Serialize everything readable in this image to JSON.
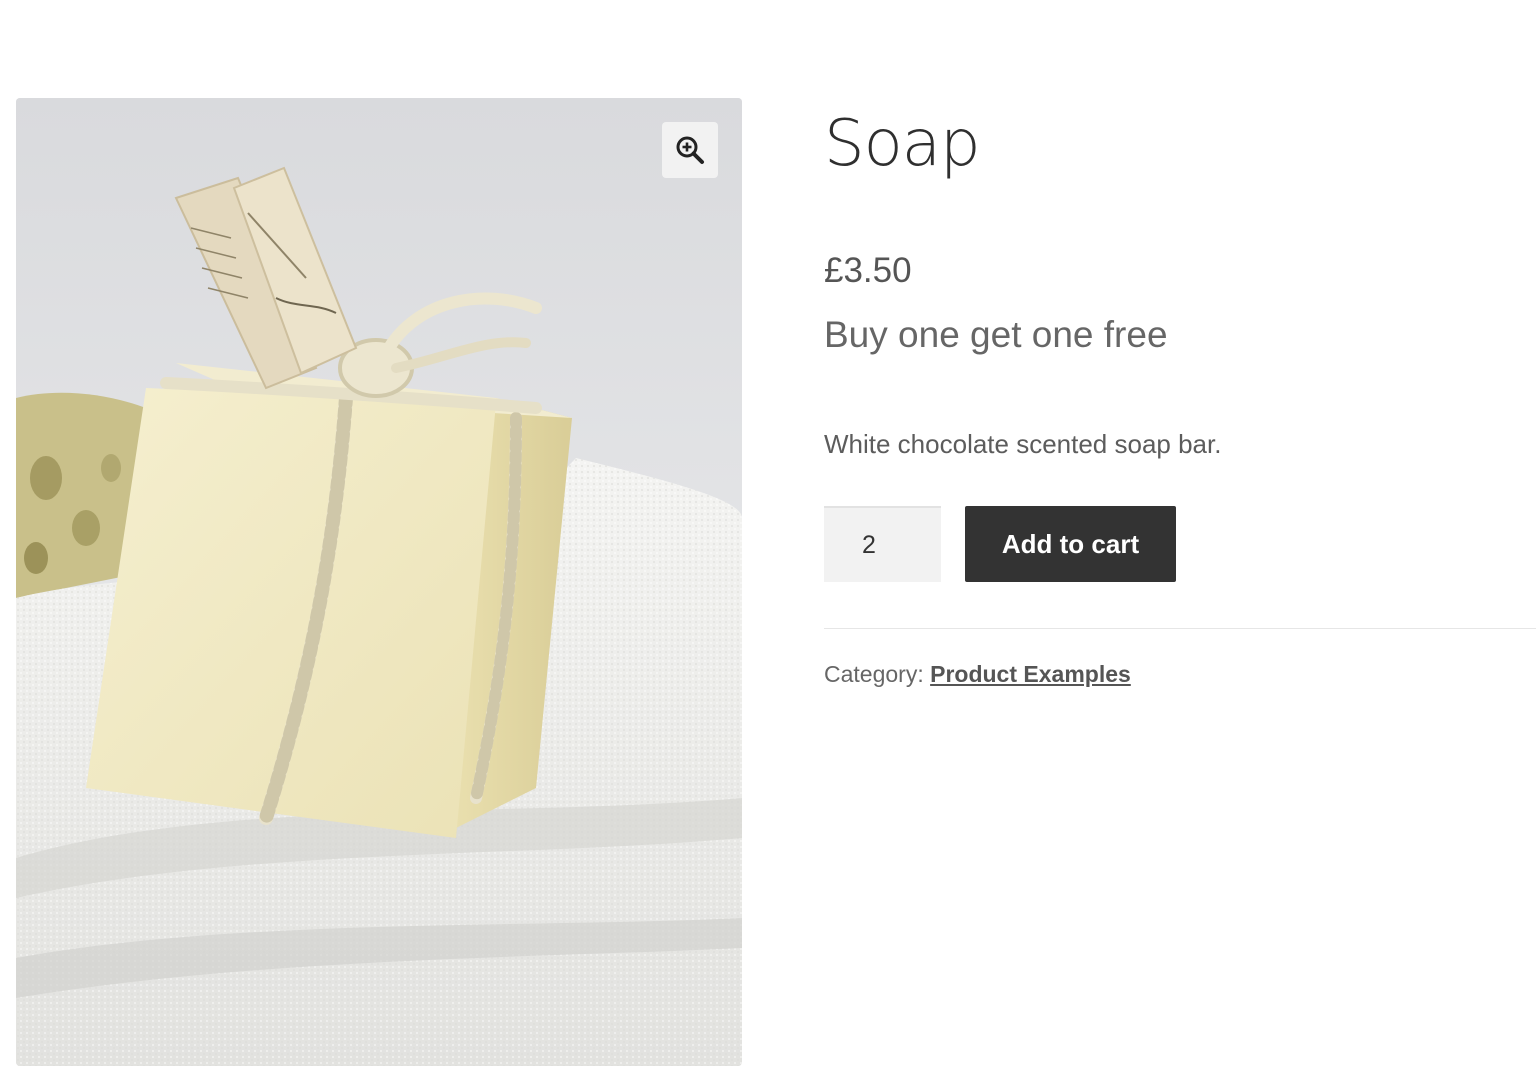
{
  "gallery": {
    "image_alt": "Soap",
    "zoom_icon": "zoom-in-icon"
  },
  "product": {
    "title": "Soap",
    "price": "£3.50",
    "offer": "Buy one get one free",
    "short_description": "White chocolate scented soap bar."
  },
  "cart": {
    "quantity": "2",
    "add_to_cart_label": "Add to cart"
  },
  "meta": {
    "category_label": "Category:",
    "category_link": "Product Examples"
  },
  "colors": {
    "button_background": "#333333",
    "text_primary": "#2f2f2f",
    "text_secondary": "#666666"
  }
}
